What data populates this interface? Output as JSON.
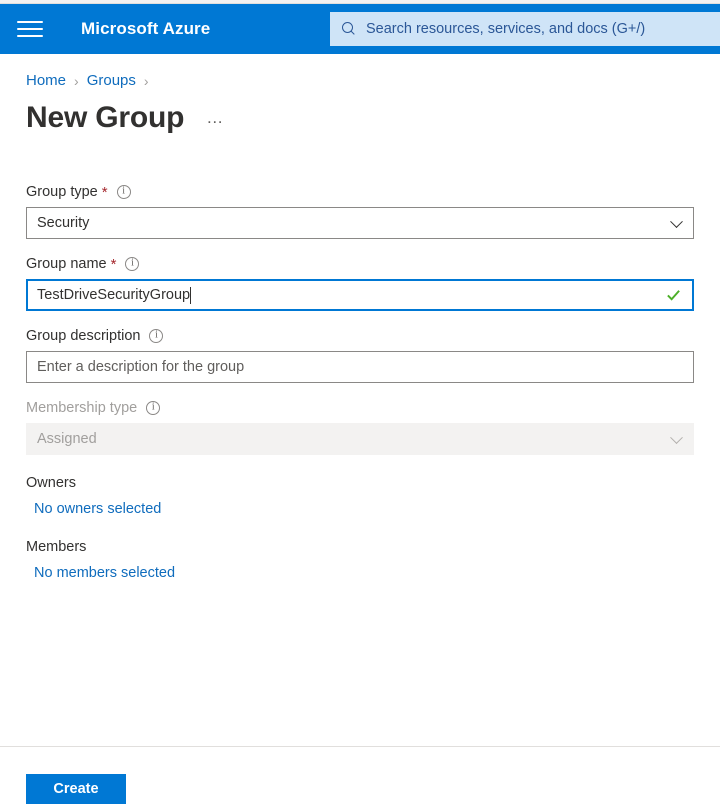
{
  "header": {
    "menu_icon": "hamburger-menu-icon",
    "brand": "Microsoft Azure",
    "search_icon": "search-icon",
    "search_placeholder": "Search resources, services, and docs (G+/)",
    "bar_color": "#0078d4",
    "search_bg": "#cfe4f7"
  },
  "breadcrumb": {
    "items": [
      {
        "label": "Home"
      },
      {
        "label": "Groups"
      }
    ],
    "separator": "›",
    "link_color": "#0f6cbd"
  },
  "page": {
    "title": "New Group",
    "more_actions": "…"
  },
  "form": {
    "group_type": {
      "label": "Group type",
      "required": true,
      "required_mark": "*",
      "info_icon": "info-icon",
      "value": "Security",
      "caret_icon": "chevron-down-icon"
    },
    "group_name": {
      "label": "Group name",
      "required": true,
      "required_mark": "*",
      "info_icon": "info-icon",
      "value": "TestDriveSecurityGroup",
      "valid_icon": "checkmark-icon",
      "valid_color": "#4caf28",
      "focus_color": "#0078d4"
    },
    "group_description": {
      "label": "Group description",
      "required": false,
      "info_icon": "info-icon",
      "value": "",
      "placeholder": "Enter a description for the group"
    },
    "membership_type": {
      "label": "Membership type",
      "required": false,
      "info_icon": "info-icon",
      "value": "Assigned",
      "disabled": true,
      "caret_icon": "chevron-down-icon"
    },
    "owners": {
      "label": "Owners",
      "link": "No owners selected"
    },
    "members": {
      "label": "Members",
      "link": "No members selected"
    }
  },
  "footer": {
    "create_label": "Create",
    "create_color": "#0078d4"
  }
}
